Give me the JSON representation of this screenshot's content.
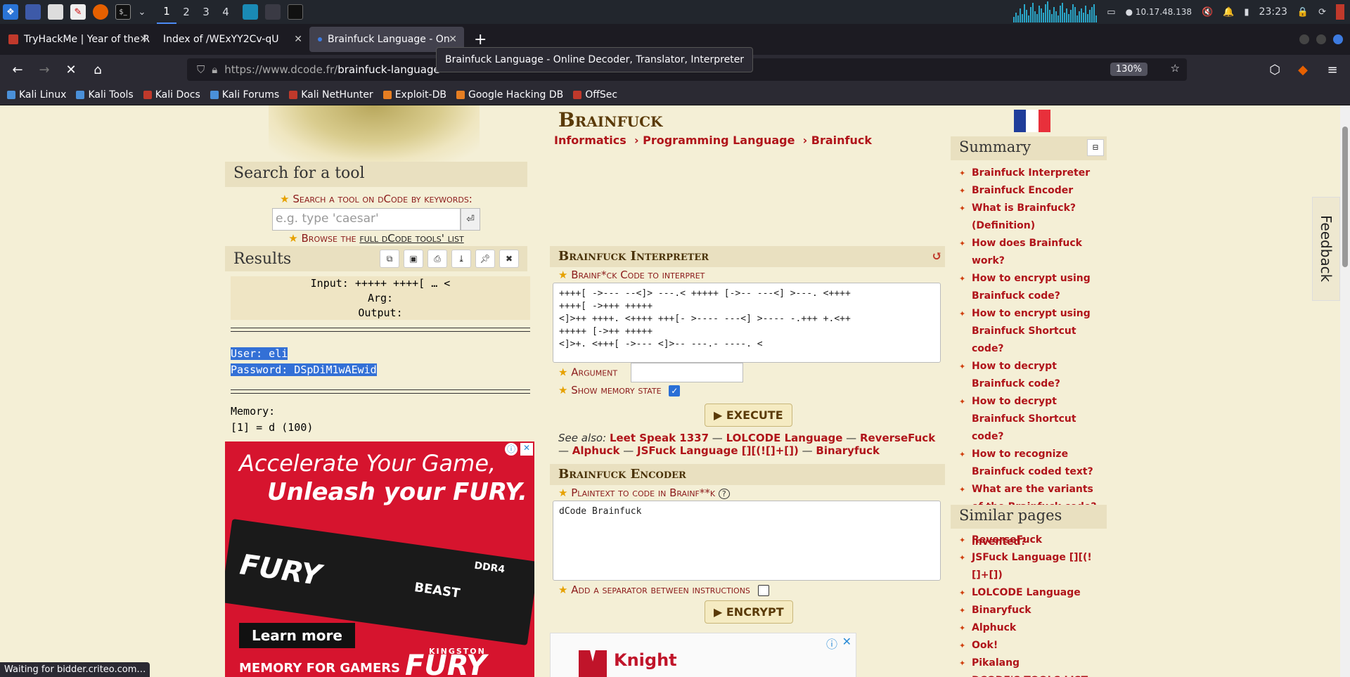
{
  "taskbar": {
    "workspaces": [
      "1",
      "2",
      "3",
      "4"
    ],
    "ip": "10.17.48.138",
    "time": "23:23"
  },
  "tabs": [
    {
      "title": "TryHackMe | Year of the R",
      "color": "#c0392b"
    },
    {
      "title": "Index of /WExYY2Cv-qU",
      "color": "#555555"
    },
    {
      "title": "Brainfuck Language - On",
      "color": "#3d7be0"
    }
  ],
  "nav": {
    "url_host": "https://www.dcode.fr/",
    "url_path": "brainfuck-language",
    "zoom": "130%",
    "tooltip": "Brainfuck Language - Online Decoder, Translator, Interpreter"
  },
  "bookmarks": [
    {
      "label": "Kali Linux",
      "color": "#4a90d9"
    },
    {
      "label": "Kali Tools",
      "color": "#4a90d9"
    },
    {
      "label": "Kali Docs",
      "color": "#c0392b"
    },
    {
      "label": "Kali Forums",
      "color": "#4a90d9"
    },
    {
      "label": "Kali NetHunter",
      "color": "#c0392b"
    },
    {
      "label": "Exploit-DB",
      "color": "#e67e22"
    },
    {
      "label": "Google Hacking DB",
      "color": "#e67e22"
    },
    {
      "label": "OffSec",
      "color": "#c0392b"
    }
  ],
  "left": {
    "search_head": "Search for a tool",
    "search_label": "Search a tool on dCode by keywords:",
    "search_placeholder": "e.g. type 'caesar'",
    "browse_prefix": "Browse the ",
    "browse_link": "full dCode tools' list",
    "results_head": "Results",
    "input_line": "Input: +++++ ++++[ … <",
    "arg_line": "Arg:",
    "output_line": "Output:",
    "user_line": "User: eli",
    "password_line": "Password: DSpDiM1wAEwid",
    "memory_label": "Memory:",
    "memory_value": "[1] = d (100)"
  },
  "ad": {
    "line1": "Accelerate Your Game,",
    "line2": "Unleash your FURY.",
    "cta": "Learn more",
    "footer": "MEMORY FOR GAMERS",
    "brand": "FURY",
    "ram_label": "FURY",
    "ram_model": "BEAST",
    "ram_type": "DDR4",
    "maker": "KINGSTON"
  },
  "main": {
    "title": "Brainfuck",
    "breadcrumb": [
      "Informatics",
      "Programming Language",
      "Brainfuck"
    ],
    "interpreter_head": "Brainfuck Interpreter",
    "code_label": "Brainf*ck Code to interpret",
    "code_text": "++++[ ->--- --<]> ---.< +++++ [->-- ---<] >---. <++++\n++++[ ->+++ +++++\n<]>++ ++++. <++++ +++[- >---- ---<] >---- -.+++ +.<++\n+++++ [->++ +++++\n<]>+. <+++[ ->--- <]>-- ---.- ----. <",
    "argument_label": "Argument",
    "memory_state_label": "Show memory state",
    "execute": "▶ EXECUTE",
    "see_also_label": "See also:",
    "see_also": [
      "Leet Speak 1337",
      "LOLCODE Language",
      "ReverseFuck",
      "Alphuck",
      "JSFuck Language [][(![]+[])",
      "Binaryfuck"
    ],
    "encoder_head": "Brainfuck Encoder",
    "plaintext_label": "Plaintext to code in Brainf**k",
    "plaintext_value": "dCode Brainfuck",
    "separator_label": "Add a separator between instructions",
    "encrypt": "▶ ENCRYPT",
    "knight_ad": "Knight"
  },
  "right": {
    "summary_head": "Summary",
    "summary": [
      "Brainfuck Interpreter",
      "Brainfuck Encoder",
      "What is Brainfuck? (Definition)",
      "How does Brainfuck work?",
      "How to encrypt using Brainfuck code?",
      "How to encrypt using Brainfuck Shortcut code?",
      "How to decrypt Brainfuck code?",
      "How to decrypt Brainfuck Shortcut code?",
      "How to recognize Brainfuck coded text?",
      "What are the variants of the Brainfuck code?",
      "When was Brainfuck invented?"
    ],
    "similar_head": "Similar pages",
    "similar": [
      "ReverseFuck",
      "JSFuck Language [][(![]+[])",
      "LOLCODE Language",
      "Binaryfuck",
      "Alphuck",
      "Ook!",
      "Pikalang",
      "DCODE'S TOOLS LIST"
    ],
    "feedback": "Feedback"
  },
  "status": "Waiting for bidder.criteo.com…",
  "colors": {
    "accent": "#b0141a",
    "bg": "#f4efd6"
  }
}
